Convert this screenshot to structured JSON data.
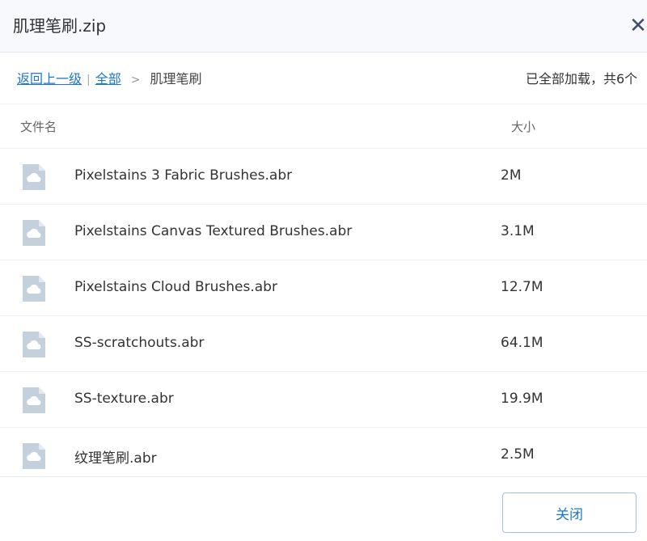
{
  "window": {
    "title": "肌理笔刷.zip",
    "close_icon": "close-icon"
  },
  "breadcrumb": {
    "back_label": "返回上一级",
    "separator": "|",
    "all_label": "全部",
    "arrow": ">",
    "current": "肌理笔刷"
  },
  "status": {
    "text": "已全部加载，共6个"
  },
  "table": {
    "columns": {
      "name": "文件名",
      "size": "大小"
    },
    "rows": [
      {
        "name": "Pixelstains 3 Fabric Brushes.abr",
        "size": "2M",
        "icon": "cloud-file-icon"
      },
      {
        "name": "Pixelstains Canvas Textured Brushes.abr",
        "size": "3.1M",
        "icon": "cloud-file-icon"
      },
      {
        "name": "Pixelstains Cloud Brushes.abr",
        "size": "12.7M",
        "icon": "cloud-file-icon"
      },
      {
        "name": "SS-scratchouts.abr",
        "size": "64.1M",
        "icon": "cloud-file-icon"
      },
      {
        "name": "SS-texture.abr",
        "size": "19.9M",
        "icon": "cloud-file-icon"
      },
      {
        "name": "纹理笔刷.abr",
        "size": "2.5M",
        "icon": "cloud-file-icon"
      }
    ]
  },
  "footer": {
    "close_label": "关闭"
  },
  "colors": {
    "link": "#1d78c9",
    "icon": "#c5d0dd",
    "titlebar_bg": "#f7f9fc"
  }
}
